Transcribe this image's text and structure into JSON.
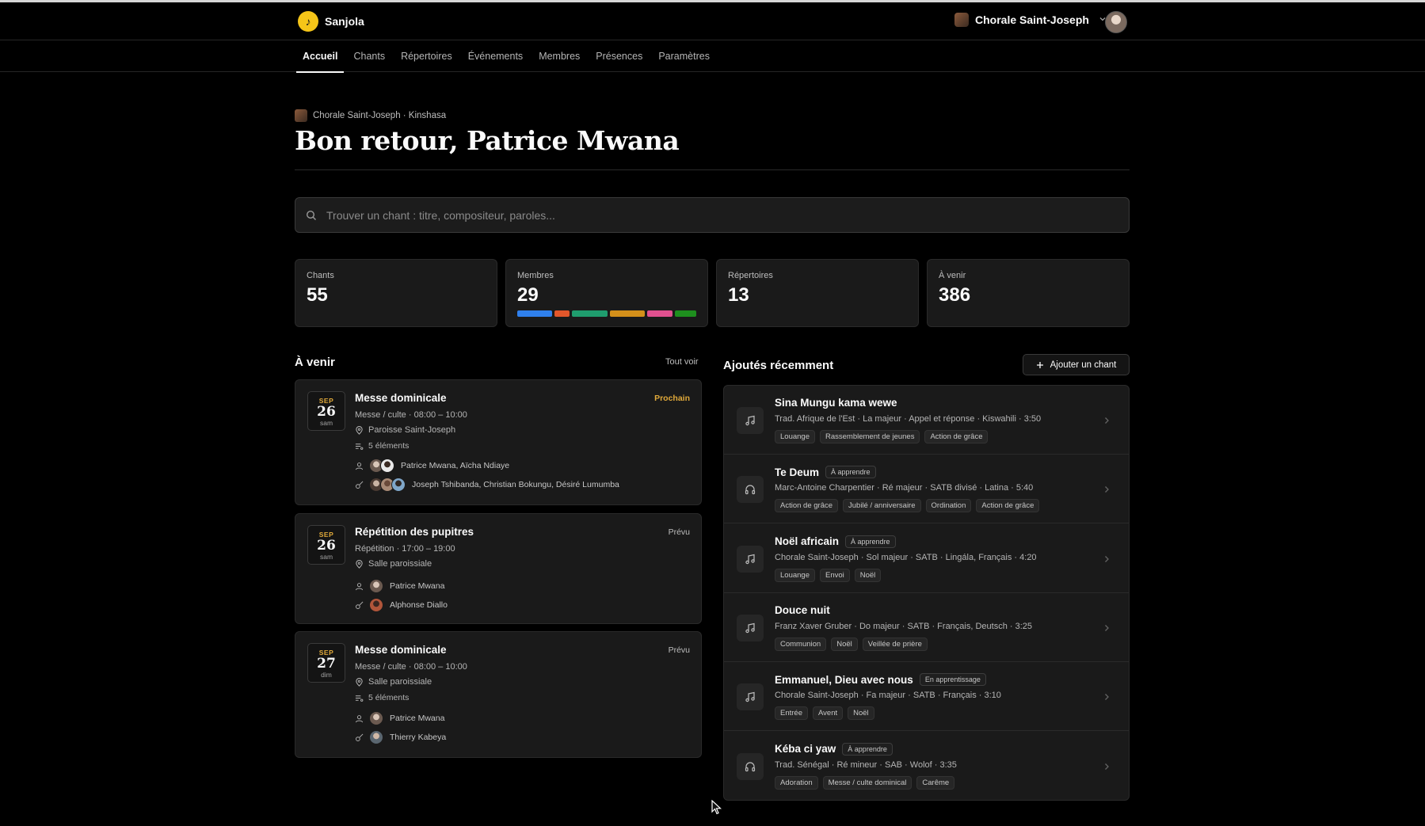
{
  "app": {
    "name": "Sanjola",
    "org_name": "Chorale Saint-Joseph"
  },
  "nav": {
    "items": [
      {
        "label": "Accueil",
        "active": true
      },
      {
        "label": "Chants"
      },
      {
        "label": "Répertoires"
      },
      {
        "label": "Événements"
      },
      {
        "label": "Membres"
      },
      {
        "label": "Présences"
      },
      {
        "label": "Paramètres"
      }
    ]
  },
  "hero": {
    "breadcrumb": "Chorale Saint-Joseph · Kinshasa",
    "title": "Bon retour, Patrice Mwana"
  },
  "search": {
    "placeholder": "Trouver un chant : titre, compositeur, paroles..."
  },
  "stats": [
    {
      "label": "Chants",
      "value": "55"
    },
    {
      "label": "Membres",
      "value": "29"
    },
    {
      "label": "Répertoires",
      "value": "13"
    },
    {
      "label": "À venir",
      "value": "386"
    }
  ],
  "members_bar": {
    "segments": [
      {
        "color": "#2f80ed",
        "share": 0.21
      },
      {
        "color": "#e2572b",
        "share": 0.09
      },
      {
        "color": "#1f9d6e",
        "share": 0.21
      },
      {
        "color": "#d4901a",
        "share": 0.21
      },
      {
        "color": "#e0508f",
        "share": 0.15
      },
      {
        "color": "#1e8f1e",
        "share": 0.13
      }
    ]
  },
  "upcoming": {
    "title": "À venir",
    "see_all": "Tout voir",
    "events": [
      {
        "month": "SEP",
        "day": "26",
        "dow": "sam",
        "title": "Messe dominicale",
        "status": "Prochain",
        "status_kind": "next",
        "time": "Messe / culte · 08:00 – 10:00",
        "place": "Paroisse Saint-Joseph",
        "items": "5 éléments",
        "leaders": "Patrice Mwana, Aïcha Ndiaye",
        "musicians": "Joseph Tshibanda, Christian Bokungu, Désiré Lumumba"
      },
      {
        "month": "SEP",
        "day": "26",
        "dow": "sam",
        "title": "Répétition des pupitres",
        "status": "Prévu",
        "status_kind": "planned",
        "time": "Répétition · 17:00 – 19:00",
        "place": "Salle paroissiale",
        "leaders": "Patrice Mwana",
        "musicians": "Alphonse Diallo"
      },
      {
        "month": "SEP",
        "day": "27",
        "dow": "dim",
        "title": "Messe dominicale",
        "status": "Prévu",
        "status_kind": "planned",
        "time": "Messe / culte · 08:00 – 10:00",
        "place": "Salle paroissiale",
        "items": "5 éléments",
        "leaders": "Patrice Mwana",
        "musicians": "Thierry Kabeya"
      }
    ]
  },
  "recent": {
    "title": "Ajoutés récemment",
    "add_button": "Ajouter un chant",
    "songs": [
      {
        "title": "Sina Mungu kama wewe",
        "icon": "music-note-icon",
        "badge": "",
        "meta": "Trad. Afrique de l'Est · La majeur · Appel et réponse · Kiswahili · 3:50",
        "tags": [
          "Louange",
          "Rassemblement de jeunes",
          "Action de grâce"
        ]
      },
      {
        "title": "Te Deum",
        "icon": "headphones-icon",
        "badge": "À apprendre",
        "meta": "Marc-Antoine Charpentier · Ré majeur · SATB divisé · Latina · 5:40",
        "tags": [
          "Action de grâce",
          "Jubilé / anniversaire",
          "Ordination",
          "Action de grâce"
        ]
      },
      {
        "title": "Noël africain",
        "icon": "music-note-icon",
        "badge": "À apprendre",
        "meta": "Chorale Saint-Joseph · Sol majeur · SATB · Lingála, Français · 4:20",
        "tags": [
          "Louange",
          "Envoi",
          "Noël"
        ]
      },
      {
        "title": "Douce nuit",
        "icon": "music-note-icon",
        "badge": "",
        "meta": "Franz Xaver Gruber · Do majeur · SATB · Français, Deutsch · 3:25",
        "tags": [
          "Communion",
          "Noël",
          "Veillée de prière"
        ]
      },
      {
        "title": "Emmanuel, Dieu avec nous",
        "icon": "music-note-icon",
        "badge": "En apprentissage",
        "meta": "Chorale Saint-Joseph · Fa majeur · SATB · Français · 3:10",
        "tags": [
          "Entrée",
          "Avent",
          "Noël"
        ]
      },
      {
        "title": "Kéba ci yaw",
        "icon": "headphones-icon",
        "badge": "À apprendre",
        "meta": "Trad. Sénégal · Ré mineur · SAB · Wolof · 3:35",
        "tags": [
          "Adoration",
          "Messe / culte dominical",
          "Carême"
        ]
      }
    ]
  }
}
